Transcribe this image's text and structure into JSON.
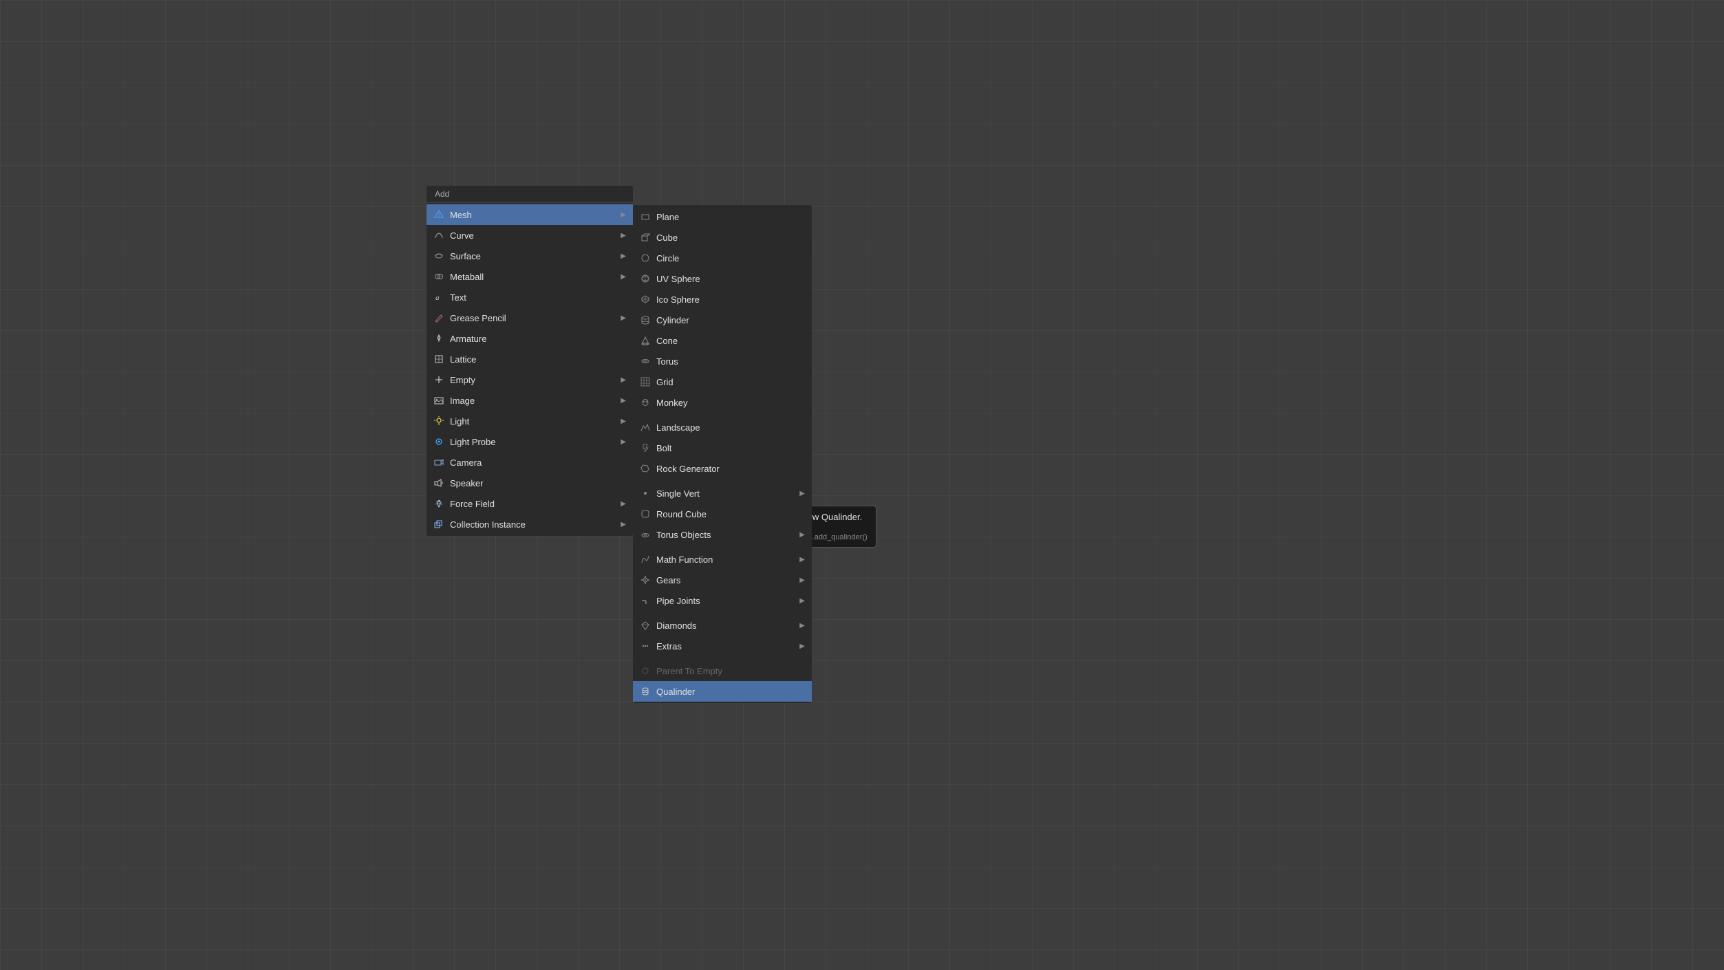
{
  "background": "#3d3d3d",
  "menu": {
    "add_label": "Add",
    "items": [
      {
        "id": "mesh",
        "label": "Mesh",
        "icon": "mesh",
        "has_submenu": true,
        "active": true
      },
      {
        "id": "curve",
        "label": "Curve",
        "icon": "curve",
        "has_submenu": true
      },
      {
        "id": "surface",
        "label": "Surface",
        "icon": "surface",
        "has_submenu": true
      },
      {
        "id": "metaball",
        "label": "Metaball",
        "icon": "meta",
        "has_submenu": true
      },
      {
        "id": "text",
        "label": "Text",
        "icon": "text",
        "has_submenu": false
      },
      {
        "id": "grease-pencil",
        "label": "Grease Pencil",
        "icon": "grease",
        "has_submenu": true
      },
      {
        "id": "armature",
        "label": "Armature",
        "icon": "armature",
        "has_submenu": false
      },
      {
        "id": "lattice",
        "label": "Lattice",
        "icon": "lattice",
        "has_submenu": false
      },
      {
        "id": "empty",
        "label": "Empty",
        "icon": "empty",
        "has_submenu": true
      },
      {
        "id": "image",
        "label": "Image",
        "icon": "image",
        "has_submenu": true
      },
      {
        "id": "light",
        "label": "Light",
        "icon": "light",
        "has_submenu": true
      },
      {
        "id": "light-probe",
        "label": "Light Probe",
        "icon": "probe",
        "has_submenu": true
      },
      {
        "id": "camera",
        "label": "Camera",
        "icon": "camera",
        "has_submenu": false
      },
      {
        "id": "speaker",
        "label": "Speaker",
        "icon": "speaker",
        "has_submenu": false
      },
      {
        "id": "force-field",
        "label": "Force Field",
        "icon": "force",
        "has_submenu": true
      },
      {
        "id": "collection-instance",
        "label": "Collection Instance",
        "icon": "collection",
        "has_submenu": true
      }
    ]
  },
  "submenu": {
    "items": [
      {
        "id": "plane",
        "label": "Plane",
        "icon": "plane",
        "has_submenu": false
      },
      {
        "id": "cube",
        "label": "Cube",
        "icon": "cube",
        "has_submenu": false
      },
      {
        "id": "circle",
        "label": "Circle",
        "icon": "circle",
        "has_submenu": false
      },
      {
        "id": "uv-sphere",
        "label": "UV Sphere",
        "icon": "sphere",
        "has_submenu": false
      },
      {
        "id": "ico-sphere",
        "label": "Ico Sphere",
        "icon": "icosphere",
        "has_submenu": false
      },
      {
        "id": "cylinder",
        "label": "Cylinder",
        "icon": "cylinder",
        "has_submenu": false
      },
      {
        "id": "cone",
        "label": "Cone",
        "icon": "cone",
        "has_submenu": false
      },
      {
        "id": "torus",
        "label": "Torus",
        "icon": "torus",
        "has_submenu": false
      },
      {
        "id": "grid",
        "label": "Grid",
        "icon": "grid",
        "has_submenu": false
      },
      {
        "id": "monkey",
        "label": "Monkey",
        "icon": "monkey",
        "has_submenu": false
      },
      {
        "id": "landscape",
        "label": "Landscape",
        "icon": "landscape",
        "has_submenu": false
      },
      {
        "id": "bolt",
        "label": "Bolt",
        "icon": "bolt",
        "has_submenu": false
      },
      {
        "id": "rock-generator",
        "label": "Rock Generator",
        "icon": "rock",
        "has_submenu": false
      },
      {
        "id": "single-vert",
        "label": "Single Vert",
        "icon": "vert",
        "has_submenu": true
      },
      {
        "id": "round-cube",
        "label": "Round Cube",
        "icon": "roundcube",
        "has_submenu": false
      },
      {
        "id": "torus-objects",
        "label": "Torus Objects",
        "icon": "torusobjs",
        "has_submenu": true
      },
      {
        "id": "math-function",
        "label": "Math Function",
        "icon": "math",
        "has_submenu": true
      },
      {
        "id": "gears",
        "label": "Gears",
        "icon": "gears",
        "has_submenu": true
      },
      {
        "id": "pipe-joints",
        "label": "Pipe Joints",
        "icon": "pipe",
        "has_submenu": true
      },
      {
        "id": "sep1",
        "type": "separator"
      },
      {
        "id": "diamonds",
        "label": "Diamonds",
        "icon": "diamonds",
        "has_submenu": true
      },
      {
        "id": "extras",
        "label": "Extras",
        "icon": "extras",
        "has_submenu": true
      },
      {
        "id": "sep2",
        "type": "separator"
      },
      {
        "id": "parent-to-empty",
        "label": "Parent To Empty",
        "icon": "parentempty",
        "disabled": true,
        "has_submenu": false
      },
      {
        "id": "qualinder",
        "label": "Qualinder",
        "icon": "qualinder",
        "highlighted": true,
        "has_submenu": false
      }
    ]
  },
  "tooltip": {
    "title": "Create a new Qualinder.",
    "python": "Python: bpy.ops.mesh.add_qualinder()"
  }
}
